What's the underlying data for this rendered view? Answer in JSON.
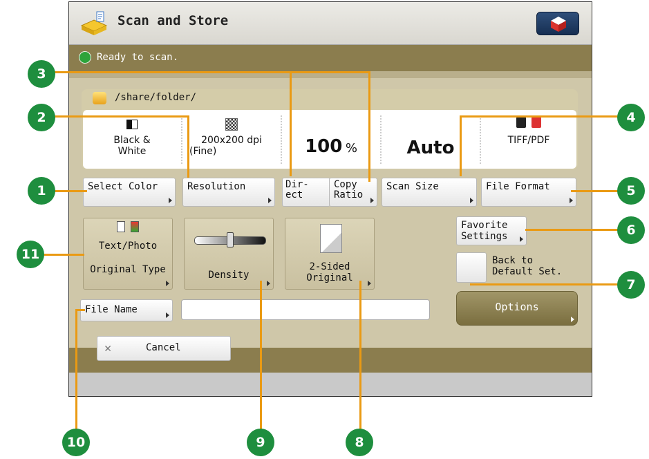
{
  "window": {
    "title": "Scan and Store"
  },
  "status": {
    "text": "Ready to scan."
  },
  "path": {
    "folder": "/share/folder/"
  },
  "settings": {
    "color_value_line1": "Black &",
    "color_value_line2": "White",
    "resolution_line1": "200x200 dpi",
    "resolution_line2": "(Fine)",
    "ratio_value": "100",
    "ratio_unit": "%",
    "scan_size_value": "Auto",
    "file_format_value": "TIFF/PDF"
  },
  "buttons": {
    "select_color": "Select Color",
    "resolution": "Resolution",
    "direct_line1": "Dir-",
    "direct_line2": "ect",
    "copy_ratio_line1": "Copy",
    "copy_ratio_line2": "Ratio",
    "scan_size": "Scan Size",
    "file_format": "File Format",
    "favorite_line1": "Favorite",
    "favorite_line2": "Settings",
    "back_default_line1": "Back to",
    "back_default_line2": "Default Set.",
    "options": "Options",
    "file_name": "File Name",
    "cancel": "Cancel"
  },
  "tiles": {
    "original_type_value": "Text/Photo",
    "original_type_label": "Original Type",
    "density_label": "Density",
    "two_sided_line1": "2-Sided",
    "two_sided_line2": "Original"
  },
  "file_name_value": "",
  "callouts": [
    "1",
    "2",
    "3",
    "4",
    "5",
    "6",
    "7",
    "8",
    "9",
    "10",
    "11"
  ],
  "colors": {
    "accent_green": "#1e8e3e",
    "callout_line": "#ea9a13",
    "status_bar": "#8b7d4e"
  },
  "icons": [
    "scanner-app-icon",
    "home-icon",
    "ready-icon",
    "folder-icon",
    "bw-color-icon",
    "checker-resolution-icon",
    "tiff-pdf-icon",
    "text-photo-icon",
    "density-slider-icon",
    "two-sided-icon",
    "cancel-icon"
  ]
}
